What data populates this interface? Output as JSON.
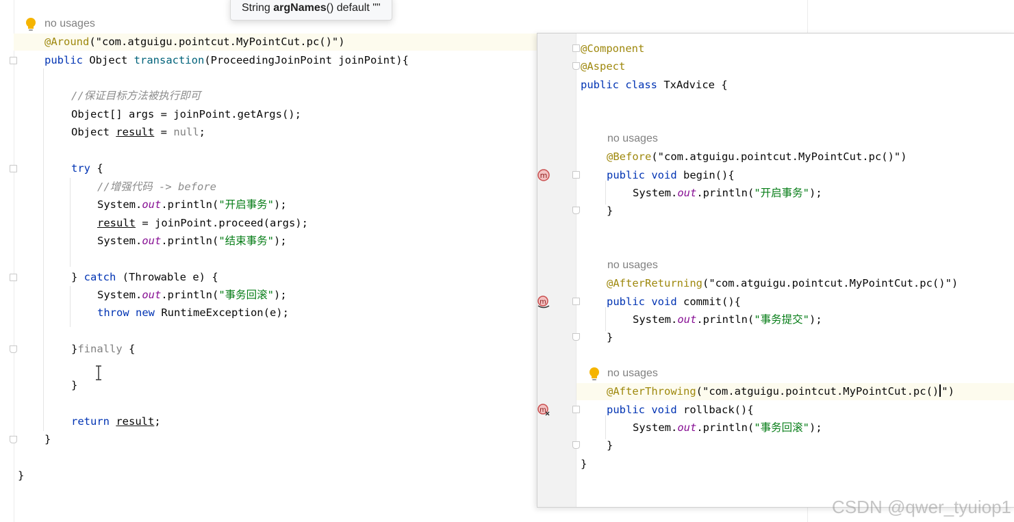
{
  "tooltip": {
    "type": "String",
    "name": "argNames",
    "rest": "() default \"\""
  },
  "left_editor": {
    "hint": "no usages",
    "ann_name": "@Around",
    "ann_arg": "(\"com.atguigu.pointcut.MyPointCut.pc()\")",
    "line_public": "public",
    "line_object": " Object ",
    "method_name": "transaction",
    "params": "(ProceedingJoinPoint joinPoint){",
    "comment1": "//保证目标方法被执行即可",
    "line_args": "Object[] args = joinPoint.getArgs();",
    "obj_kw": "Object ",
    "result_var": "result",
    "assign_null_eq": " = ",
    "null_kw": "null",
    "semi": ";",
    "try_kw": "try",
    "brace_open": " {",
    "comment2": "//增强代码 -> before",
    "sysout_prefix": "System.",
    "out": "out",
    "println_open": ".println(",
    "str_begin": "\"开启事务\"",
    "close_stmt": ");",
    "proceed_rest": " = joinPoint.proceed(args);",
    "str_end": "\"结束事务\"",
    "catch_open": "} ",
    "catch_kw": "catch",
    "catch_rest": " (Throwable e) {",
    "str_rollback": "\"事务回滚\"",
    "throw_kw": "throw",
    "new_kw": " new",
    "throw_rest": " RuntimeException(e);",
    "finally_brace": "}",
    "finally_kw": "finally",
    "finally_open": " {",
    "close_brace": "}",
    "return_kw": "return",
    "return_space": " ",
    "method_close": "}",
    "class_close": "}"
  },
  "right_editor": {
    "ann_component": "@Component",
    "ann_aspect": "@Aspect",
    "class_public": "public",
    "class_kw": " class",
    "class_name": " TxAdvice {",
    "hint1": "no usages",
    "before_ann": "@Before",
    "pointcut_arg": "(\"com.atguigu.pointcut.MyPointCut.pc()\")",
    "public_kw": "public",
    "void_kw": " void",
    "begin_sig": " begin(){",
    "sysout_prefix": "System.",
    "out": "out",
    "println_open": ".println(",
    "str_begin": "\"开启事务\"",
    "close_stmt": ");",
    "close_brace": "}",
    "hint2": "no usages",
    "afterreturning_ann": "@AfterReturning",
    "afterreturning_arg": "(\"com.atguigu.pointcut.MyPointCut.pc()\")",
    "commit_sig": " commit(){",
    "str_commit": "\"事务提交\"",
    "hint3": "no usages",
    "afterthrowing_ann": "@AfterThrowing",
    "afterthrowing_arg_a": "(\"com.atguigu.pointcut.MyPointCut.pc()",
    "afterthrowing_arg_b": "\")",
    "rollback_sig": " rollback(){",
    "str_rollback": "\"事务回滚\"",
    "class_close": "}"
  },
  "watermark": "CSDN @qwer_tyuiop1",
  "colors": {
    "keyword": "#0033b3",
    "annotation": "#9e880d",
    "string": "#067d17",
    "comment": "#8c8c8c",
    "static_field": "#871094",
    "caret_row": "#fdfbee"
  }
}
